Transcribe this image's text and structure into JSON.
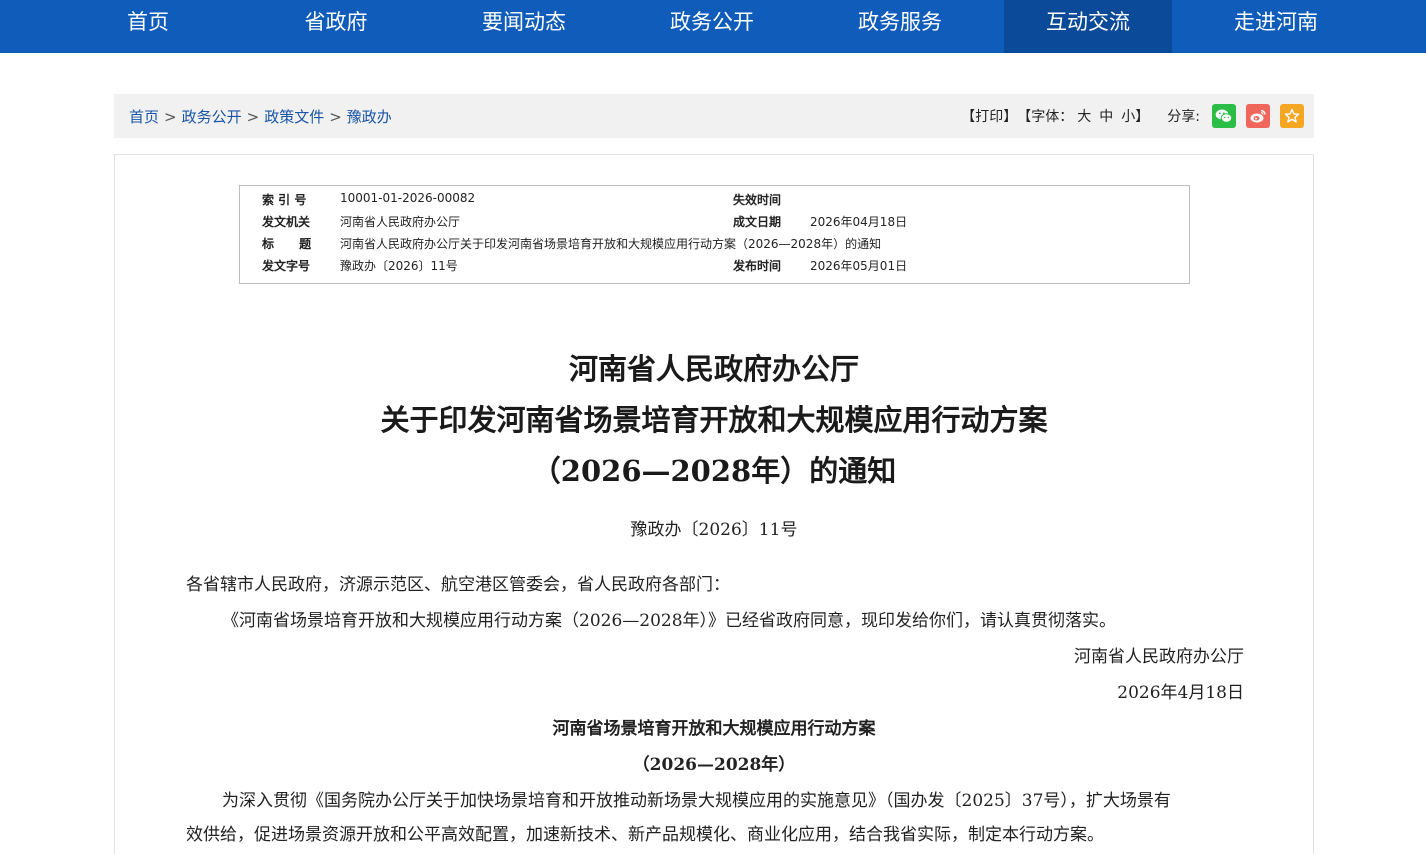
{
  "nav": [
    "首页",
    "省政府",
    "要闻动态",
    "政务公开",
    "政务服务",
    "互动交流",
    "走进河南"
  ],
  "breadcrumb": [
    "首页",
    "政务公开",
    "政策文件",
    "豫政办"
  ],
  "breadcrumb_sep": ">",
  "tools": {
    "print": "【打印】",
    "font_label": "【字体：",
    "size_large": "大",
    "size_medium": "中",
    "size_small": "小",
    "font_close": "】",
    "share_label": "分享:",
    "share_icons": [
      "wechat-icon",
      "weibo-icon",
      "favorite-star-icon"
    ],
    "share_colors": [
      "#2bbd45",
      "#f0665a",
      "#f5a623"
    ]
  },
  "info": {
    "index_label": "索 引 号",
    "index_value": "10001-01-2026-00082",
    "expire_label": "失效时间",
    "expire_value": "",
    "issuer_label": "发文机关",
    "issuer_value": "河南省人民政府办公厅",
    "made_label": "成文日期",
    "made_value": "2026年04月18日",
    "title_label": "标      题",
    "title_value": "河南省人民政府办公厅关于印发河南省场景培育开放和大规模应用行动方案（2026—2028年）的通知",
    "docno_label": "发文字号",
    "docno_value": "豫政办〔2026〕11号",
    "publish_label": "发布时间",
    "publish_value": "2026年05月01日"
  },
  "article": {
    "title_lines": [
      "河南省人民政府办公厅",
      "关于印发河南省场景培育开放和大规模应用行动方案",
      "（2026—2028年）的通知"
    ],
    "doc_number": "豫政办〔2026〕11号",
    "addressee": "各省辖市人民政府，济源示范区、航空港区管委会，省人民政府各部门：",
    "body1": "《河南省场景培育开放和大规模应用行动方案（2026—2028年）》已经省政府同意，现印发给你们，请认真贯彻落实。",
    "signature": "河南省人民政府办公厅",
    "date": "2026年4月18日",
    "plan_title": "河南省场景培育开放和大规模应用行动方案",
    "plan_subtitle": "（2026—2028年）",
    "body2_line1": "为深入贯彻《国务院办公厅关于加快场景培育和开放推动新场景大规模应用的实施意见》（国办发〔2025〕37号），扩大场景有",
    "body2_line2": "效供给，促进场景资源开放和公平高效配置，加速新技术、新产品规模化、商业化应用，结合我省实际，制定本行动方案。"
  }
}
